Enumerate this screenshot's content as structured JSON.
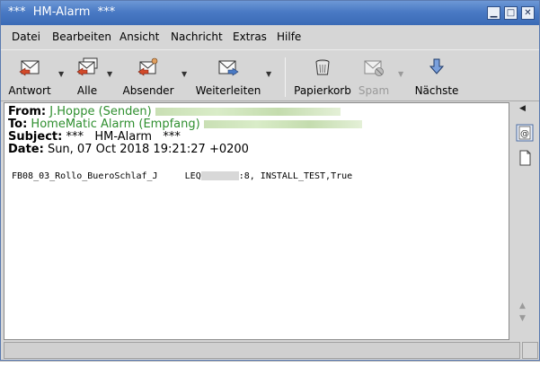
{
  "window": {
    "title": "***  HM-Alarm  ***"
  },
  "wm_buttons": {
    "minimize": "▁",
    "maximize": "□",
    "close": "✕"
  },
  "menubar": [
    "Datei",
    "Bearbeiten",
    "Ansicht",
    "Nachricht",
    "Extras",
    "Hilfe"
  ],
  "toolbar": {
    "reply_label": "Antwort",
    "reply_all_label": "Alle",
    "sender_label": "Absender",
    "forward_label": "Weiterleiten",
    "trash_label": "Papierkorb",
    "spam_label": "Spam",
    "next_label": "Nächste"
  },
  "message": {
    "from_key": "From:",
    "from_value": "J.Hoppe (Senden)",
    "to_key": "To:",
    "to_value": "HomeMatic Alarm (Empfang)",
    "subject_key": "Subject:",
    "subject_value": "***   HM-Alarm   ***",
    "date_key": "Date:",
    "date_value": "Sun, 07 Oct 2018 19:21:27 +0200",
    "body_part1": "FB08_03_Rollo_BueroSchlaf_J     LEQ",
    "body_part2": ":8, INSTALL_TEST,True"
  },
  "icons": {
    "reply": "reply-icon",
    "reply_all": "reply-all-icon",
    "sender": "sender-icon",
    "forward": "forward-icon",
    "trash": "trash-icon",
    "spam": "spam-icon",
    "next": "next-arrow-icon",
    "side_attach": "attachment-at-icon",
    "side_doc": "document-icon"
  },
  "colors": {
    "titlebar": "#4a7ac4",
    "link": "#2f8f2f",
    "chrome": "#d6d6d6"
  }
}
